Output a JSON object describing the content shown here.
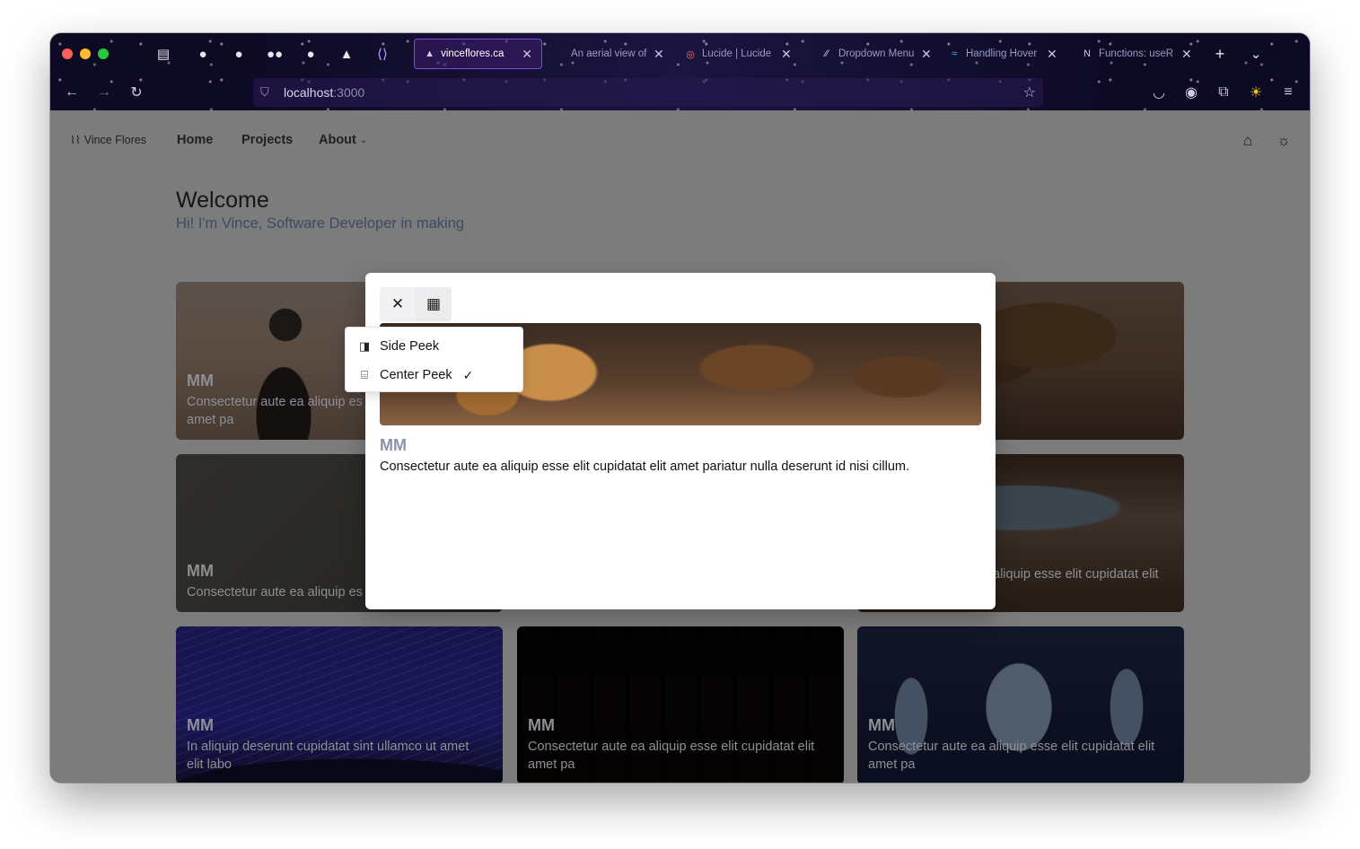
{
  "browser": {
    "tabs": [
      {
        "title": "vinceflores.ca",
        "active": true,
        "favicon": "triangle-icon"
      },
      {
        "title": "An aerial view of",
        "active": false,
        "favicon": ""
      },
      {
        "title": "Lucide | Lucide",
        "active": false,
        "favicon": "lucide-icon"
      },
      {
        "title": "Dropdown Menu",
        "active": false,
        "favicon": "radix-icon"
      },
      {
        "title": "Handling Hover",
        "active": false,
        "favicon": "tailwind-icon"
      },
      {
        "title": "Functions: useR",
        "active": false,
        "favicon": "next-icon"
      }
    ],
    "url": "localhost",
    "port": ":3000"
  },
  "nav": {
    "brand": "Vince Flores",
    "links": [
      "Home",
      "Projects",
      "About"
    ]
  },
  "hero": {
    "title": "Welcome",
    "subtitle": "Hi! I'm Vince, Software Developer in making"
  },
  "cards": [
    {
      "tag": "MM",
      "desc": "Consectetur aute ea aliquip es\namet pa"
    },
    {
      "tag": "MM",
      "desc": "Consectetur aute ea aliquip es"
    },
    {
      "tag": "MM",
      "desc": "aliquip esse elit cupidatat elit"
    },
    {
      "tag": "MM",
      "desc": "In aliquip deserunt cupidatat sint ullamco ut amet elit labo"
    },
    {
      "tag": "MM",
      "desc": "Consectetur aute ea aliquip esse elit cupidatat elit amet pa"
    },
    {
      "tag": "MM",
      "desc": "Consectetur aute ea aliquip esse elit cupidatat elit amet pa"
    }
  ],
  "modal": {
    "tag": "MM",
    "desc": "Consectetur aute ea aliquip esse elit cupidatat elit amet pariatur nulla deserunt id nisi cillum."
  },
  "menu": {
    "items": [
      {
        "label": "Side Peek",
        "icon": "panel-right-icon",
        "checked": false
      },
      {
        "label": "Center Peek",
        "icon": "panel-center-icon",
        "checked": true
      }
    ]
  }
}
